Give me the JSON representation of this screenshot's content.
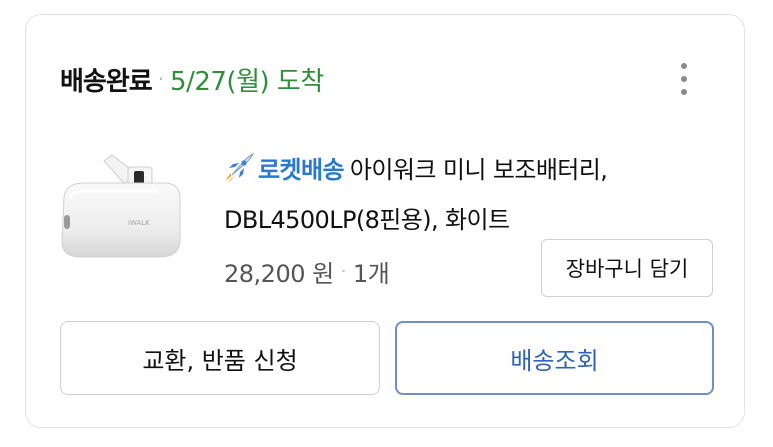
{
  "order": {
    "status": "배송완료",
    "separator": "·",
    "arrival": "5/27(월) 도착",
    "more_icon": "more-vertical-icon"
  },
  "product": {
    "image": "power-bank-image",
    "badge_icon": "rocket-icon",
    "badge": "로켓배송",
    "name": "아이워크 미니 보조배터리, DBL4500LP(8핀용), 화이트",
    "price": "28,200 원",
    "separator": "·",
    "quantity": "1개"
  },
  "buttons": {
    "add_to_cart": "장바구니 담기",
    "exchange_return": "교환, 반품 신청",
    "track_delivery": "배송조회"
  },
  "colors": {
    "arrival_green": "#2f8f3a",
    "rocket_blue": "#2a79d1",
    "track_border": "#6f8fc9",
    "track_text": "#2f62b8"
  }
}
